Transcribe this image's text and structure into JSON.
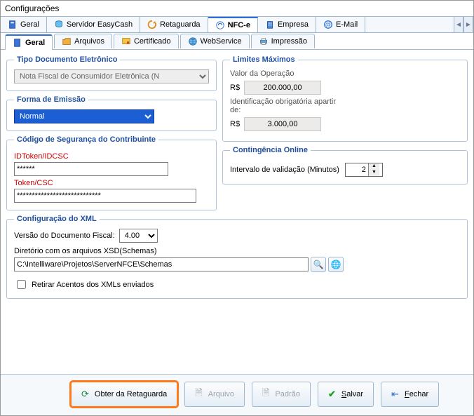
{
  "window": {
    "title": "Configurações"
  },
  "mainTabs": {
    "items": [
      {
        "label": "Geral"
      },
      {
        "label": "Servidor EasyCash"
      },
      {
        "label": "Retaguarda"
      },
      {
        "label": "NFC-e"
      },
      {
        "label": "Empresa"
      },
      {
        "label": "E-Mail"
      }
    ]
  },
  "subTabs": {
    "items": [
      {
        "label": "Geral"
      },
      {
        "label": "Arquivos"
      },
      {
        "label": "Certificado"
      },
      {
        "label": "WebService"
      },
      {
        "label": "Impressão"
      }
    ]
  },
  "tipoDoc": {
    "legend": "Tipo Documento Eletrônico",
    "value": "Nota Fiscal de Consumidor Eletrônica (N"
  },
  "formaEmissao": {
    "legend": "Forma de Emissão",
    "value": "Normal"
  },
  "codigoSeguranca": {
    "legend": "Código de Segurança do Contribuinte",
    "idtoken_label": "IDToken/IDCSC",
    "idtoken_value": "******",
    "token_label": "Token/CSC",
    "token_value": "****************************"
  },
  "limites": {
    "legend": "Limites Máximos",
    "valor_label": "Valor da Operação",
    "currency": "R$",
    "valor": "200.000,00",
    "ident_label": "Identificação obrigatória apartir de:",
    "ident_valor": "3.000,00"
  },
  "contingencia": {
    "legend": "Contingência Online",
    "intervalo_label": "Intervalo de validação (Minutos)",
    "intervalo_value": "2"
  },
  "xml": {
    "legend": "Configuração do XML",
    "versao_label": "Versão do Documento Fiscal:",
    "versao_value": "4.00",
    "dir_label": "Diretório com os arquivos XSD(Schemas)",
    "dir_value": "C:\\Intelliware\\Projetos\\ServerNFCE\\Schemas",
    "retirar_label": "Retirar Acentos dos XMLs enviados"
  },
  "buttons": {
    "obter": "Obter da Retaguarda",
    "arquivo": "Arquivo",
    "padrao": "Padrão",
    "salvar": "Salvar",
    "fechar": "Fechar"
  }
}
